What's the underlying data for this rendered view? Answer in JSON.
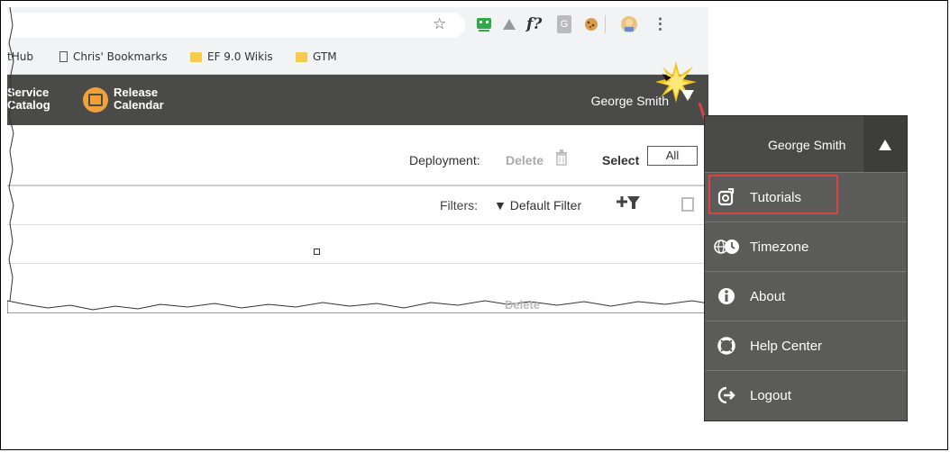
{
  "browser": {
    "bookmarks": [
      {
        "label": "tHub",
        "icon": "none"
      },
      {
        "label": "Chris' Bookmarks",
        "icon": "page-icon"
      },
      {
        "label": "EF 9.0 Wikis",
        "icon": "folder-icon"
      },
      {
        "label": "GTM",
        "icon": "folder-icon"
      }
    ],
    "toolbar_icons": [
      "star-icon",
      "extension-green-icon",
      "drive-icon",
      "f-question-icon",
      "g-extension-icon",
      "cookie-icon",
      "avatar-icon",
      "kebab-menu-icon"
    ],
    "f_icon_text": "f?",
    "g_icon_text": "G",
    "kebab": "⋮"
  },
  "appbar": {
    "nav_service": "Service\nCatalog",
    "nav_service_line1": "Service",
    "nav_service_line2": "Catalog",
    "nav_release_line1": "Release",
    "nav_release_line2": "Calendar",
    "user_name": "George Smith"
  },
  "deployment_bar": {
    "label": "Deployment:",
    "delete_label": "Delete",
    "select_label": "Select",
    "select_value": "All"
  },
  "filter_bar": {
    "label": "Filters:",
    "value": "▼ Default Filter"
  },
  "torn_text": "Delete",
  "menu": {
    "user_name": "George Smith",
    "items": [
      {
        "label": "Tutorials",
        "icon": "tutorial-icon",
        "highlighted": true
      },
      {
        "label": "Timezone",
        "icon": "timezone-icon",
        "highlighted": false
      },
      {
        "label": "About",
        "icon": "info-icon",
        "highlighted": false
      },
      {
        "label": "Help Center",
        "icon": "lifebuoy-icon",
        "highlighted": false
      },
      {
        "label": "Logout",
        "icon": "logout-icon",
        "highlighted": false
      }
    ]
  },
  "colors": {
    "appbar": "#4a4a48",
    "menu_bg": "#5b5b59",
    "calendar_accent": "#f0a23a",
    "highlight": "#d9443f"
  }
}
